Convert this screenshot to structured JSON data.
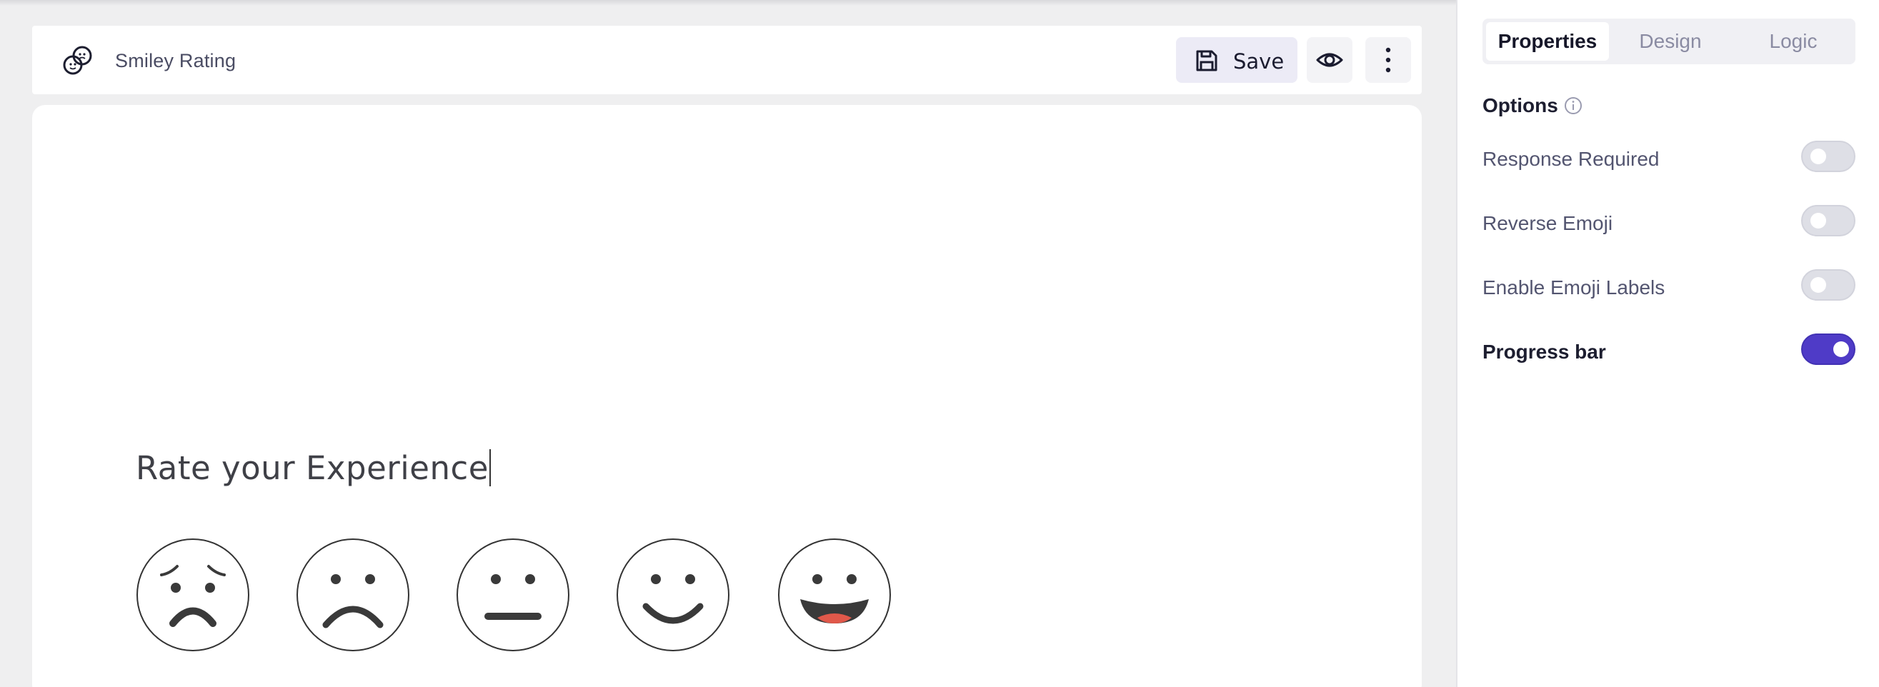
{
  "header": {
    "title": "Smiley Rating",
    "save_label": "Save",
    "icons": {
      "form": "smiley-link-icon",
      "save": "save-icon",
      "preview": "eye-icon",
      "more": "more-vertical-icon"
    }
  },
  "canvas": {
    "question": "Rate your Experience",
    "smileys": [
      "very-sad-face-icon",
      "sad-face-icon",
      "neutral-face-icon",
      "happy-face-icon",
      "very-happy-face-icon"
    ]
  },
  "panel": {
    "tabs": [
      {
        "label": "Properties",
        "active": true
      },
      {
        "label": "Design",
        "active": false
      },
      {
        "label": "Logic",
        "active": false
      }
    ],
    "options_title": "Options",
    "options": [
      {
        "label": "Response Required",
        "enabled": false
      },
      {
        "label": "Reverse Emoji",
        "enabled": false
      },
      {
        "label": "Enable Emoji Labels",
        "enabled": false
      },
      {
        "label": "Progress bar",
        "enabled": true
      }
    ]
  },
  "colors": {
    "accent": "#4f3bc7",
    "toggle_off": "#dedfe6",
    "smile_tongue": "#e0584a",
    "face_stroke": "#333333"
  }
}
